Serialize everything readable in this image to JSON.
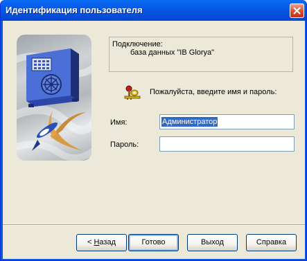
{
  "window": {
    "title": "Идентификация пользователя"
  },
  "connection": {
    "label": "Подключение:",
    "database": "база данных \"IB Glorya\""
  },
  "prompt": "Пожалуйста, введите имя и пароль:",
  "name_field": {
    "label": "Имя:",
    "value": "Администратор"
  },
  "password_field": {
    "label": "Пароль:",
    "value": ""
  },
  "buttons": {
    "back_prefix": "< ",
    "back_mnemonic": "Н",
    "back_rest": "азад",
    "ok": "Готово",
    "exit": "Выход",
    "help": "Справка"
  },
  "icons": {
    "close": "close-icon",
    "safe": "safe-icon",
    "bird": "swallow-bird-icon",
    "keys": "keys-icon"
  },
  "colors": {
    "titlebar": "#0558e6",
    "dialog_bg": "#ece9d8",
    "selection": "#316ac5",
    "close_button": "#d8462a"
  }
}
